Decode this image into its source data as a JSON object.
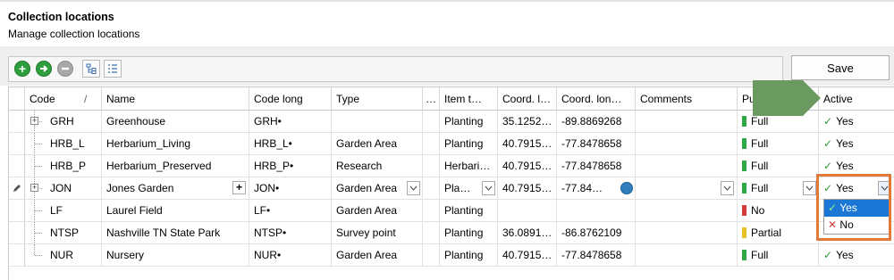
{
  "header": {
    "title": "Collection locations",
    "subtitle": "Manage collection locations"
  },
  "toolbar": {
    "save_label": "Save"
  },
  "columns": {
    "code": "Code",
    "code_sort": "/",
    "name": "Name",
    "code_long": "Code long",
    "type": "Type",
    "more": "…",
    "item_type": "Item t…",
    "coord_lat": "Coord. l…",
    "coord_lon": "Coord. lon…",
    "comments": "Comments",
    "purpose": "Pu",
    "active": "Active"
  },
  "rows": [
    {
      "code": "GRH",
      "name": "Greenhouse",
      "code_long": "GRH•",
      "type": "",
      "item_type": "Planting",
      "coord_lat": "35.1252…",
      "coord_lon": "-89.8869268",
      "comments": "",
      "purpose": "Full",
      "active": "Yes"
    },
    {
      "code": "HRB_L",
      "name": "Herbarium_Living",
      "code_long": "HRB_L•",
      "type": "Garden Area",
      "item_type": "Planting",
      "coord_lat": "40.7915…",
      "coord_lon": "-77.8478658",
      "comments": "",
      "purpose": "Full",
      "active": "Yes"
    },
    {
      "code": "HRB_P",
      "name": "Herbarium_Preserved",
      "code_long": "HRB_P•",
      "type": "Research",
      "item_type": "Herbari…",
      "coord_lat": "40.7915…",
      "coord_lon": "-77.8478658",
      "comments": "",
      "purpose": "Full",
      "active": "Yes"
    },
    {
      "code": "JON",
      "name": "Jones Garden",
      "code_long": "JON•",
      "type": "Garden Area",
      "item_type": "Pla…",
      "coord_lat": "40.7915…",
      "coord_lon": "-77.84…",
      "comments": "",
      "purpose": "Full",
      "active": "Yes"
    },
    {
      "code": "LF",
      "name": "Laurel Field",
      "code_long": "LF•",
      "type": "Garden Area",
      "item_type": "Planting",
      "coord_lat": "",
      "coord_lon": "",
      "comments": "",
      "purpose": "No",
      "active": ""
    },
    {
      "code": "NTSP",
      "name": "Nashville TN State Park",
      "code_long": "NTSP•",
      "type": "Survey point",
      "item_type": "Planting",
      "coord_lat": "36.0891…",
      "coord_lon": "-86.8762109",
      "comments": "",
      "purpose": "Partial",
      "active": ""
    },
    {
      "code": "NUR",
      "name": "Nursery",
      "code_long": "NUR•",
      "type": "Garden Area",
      "item_type": "Planting",
      "coord_lat": "40.7915…",
      "coord_lon": "-77.8478658",
      "comments": "",
      "purpose": "Full",
      "active": "Yes"
    }
  ],
  "dropdown": {
    "options": [
      "Yes",
      "No"
    ],
    "selected": "Yes"
  },
  "colors": {
    "purpose_full": "#2fa847",
    "purpose_no": "#d33a3a",
    "purpose_partial": "#e6c229",
    "highlight": "#e07a3a",
    "arrow": "#6a9a60",
    "selection": "#1a77d6"
  },
  "icons": {
    "add": "add-icon",
    "next": "arrow-right-icon",
    "remove": "remove-icon",
    "tree": "tree-view-icon",
    "list": "list-view-icon",
    "edit": "pencil-icon",
    "globe": "globe-icon"
  }
}
